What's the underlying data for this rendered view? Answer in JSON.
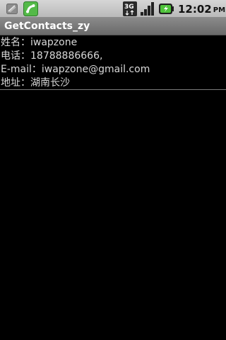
{
  "status_bar": {
    "time": "12:02",
    "ampm": "PM",
    "network_label": "3G",
    "icons": [
      "notification-icon",
      "phone-call-icon",
      "3g-network-icon",
      "signal-strength-icon",
      "battery-charging-icon"
    ]
  },
  "app": {
    "title": "GetContacts_zy"
  },
  "contact": {
    "name_line": "姓名：iwapzone",
    "phone_line": "电话：18788886666,",
    "email_line": "E-mail：iwapzone@gmail.com",
    "address_line": "地址：湖南长沙"
  }
}
